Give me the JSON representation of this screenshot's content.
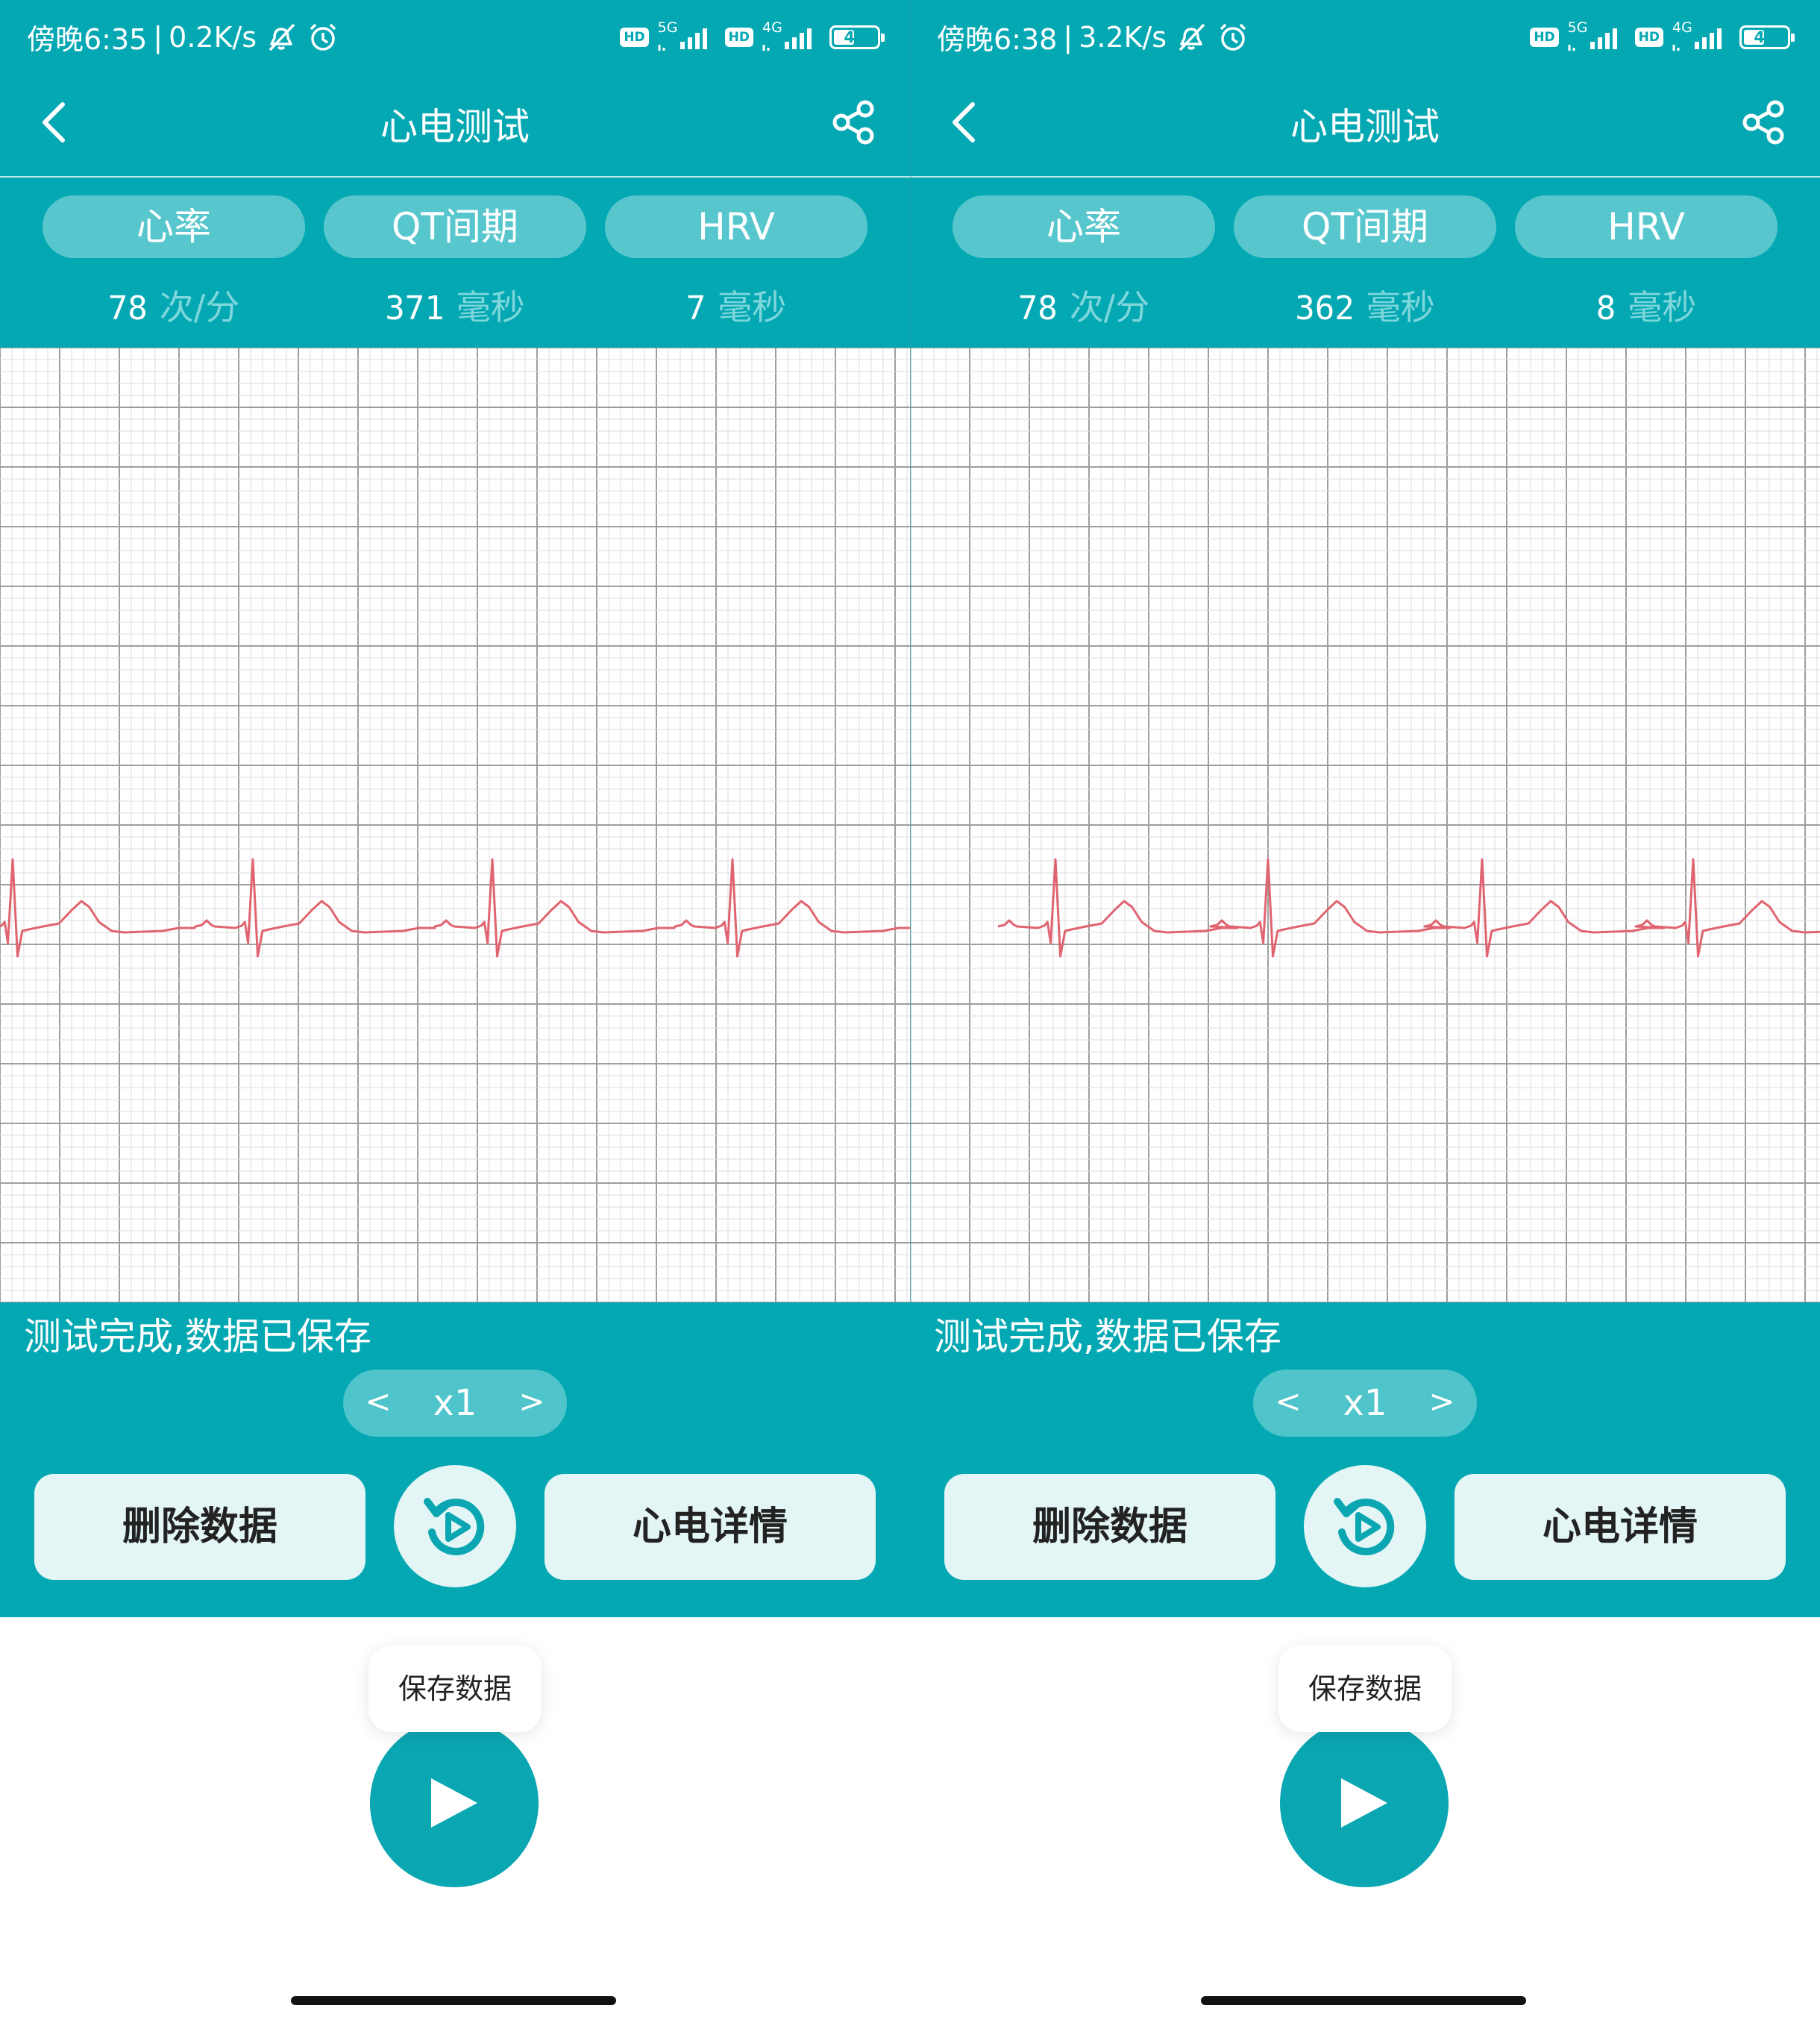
{
  "colors": {
    "teal": "#04a8b3",
    "pill": "#58c7cd",
    "unit": "#7fd7dc",
    "ecg_trace": "#e06470",
    "button_bg": "#e3f5f5"
  },
  "screens": [
    {
      "status": {
        "time": "傍晚6:35",
        "net_speed": "0.2K/s",
        "net1": "5G",
        "net2": "4G",
        "hd1": "HD",
        "hd2": "HD",
        "battery": "48",
        "battery_level": 0.48,
        "icons": [
          "vibrate-off-icon",
          "alarm-icon"
        ]
      },
      "header": {
        "title": "心电测试",
        "back_icon": "back-chevron-icon",
        "share_icon": "share-icon"
      },
      "tabs": [
        {
          "label": "心率",
          "value": "78",
          "unit": "次/分"
        },
        {
          "label": "QT间期",
          "value": "371",
          "unit": "毫秒"
        },
        {
          "label": "HRV",
          "value": "7",
          "unit": "毫秒"
        }
      ],
      "message": "测试完成,数据已保存",
      "speed": {
        "prev": "<",
        "value": "x1",
        "next": ">"
      },
      "buttons": {
        "delete": "删除数据",
        "detail": "心电详情"
      },
      "tooltip": "保存数据"
    },
    {
      "status": {
        "time": "傍晚6:38",
        "net_speed": "3.2K/s",
        "net1": "5G",
        "net2": "4G",
        "hd1": "HD",
        "hd2": "HD",
        "battery": "48",
        "battery_level": 0.48,
        "icons": [
          "vibrate-off-icon",
          "alarm-icon"
        ]
      },
      "header": {
        "title": "心电测试",
        "back_icon": "back-chevron-icon",
        "share_icon": "share-icon"
      },
      "tabs": [
        {
          "label": "心率",
          "value": "78",
          "unit": "次/分"
        },
        {
          "label": "QT间期",
          "value": "362",
          "unit": "毫秒"
        },
        {
          "label": "HRV",
          "value": "8",
          "unit": "毫秒"
        }
      ],
      "message": "测试完成,数据已保存",
      "speed": {
        "prev": "<",
        "value": "x1",
        "next": ">"
      },
      "buttons": {
        "delete": "删除数据",
        "detail": "心电详情"
      },
      "tooltip": "保存数据"
    }
  ]
}
